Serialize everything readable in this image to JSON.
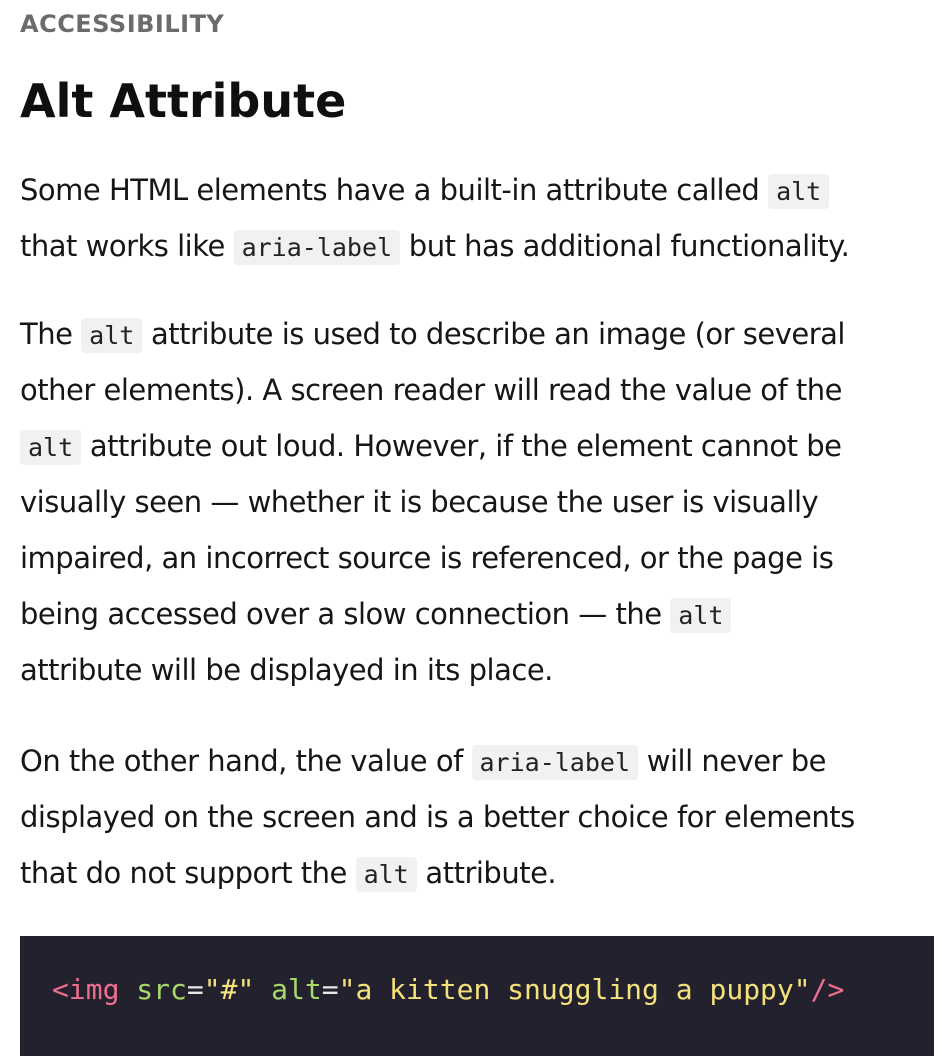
{
  "eyebrow": "ACCESSIBILITY",
  "title": "Alt Attribute",
  "para1": {
    "l1_a": "Some HTML elements have a built-in attribute called ",
    "l1_code": "alt",
    "l2_a": "that works like ",
    "l2_code": "aria-label",
    "l2_b": " but has additional functionality."
  },
  "para2": {
    "l1_a": "The ",
    "l1_code": "alt",
    "l1_b": " attribute is used to describe an image (or several",
    "l2": "other elements). A screen reader will read the value of the",
    "l3_code": "alt",
    "l3_b": " attribute out loud. However, if the element cannot be",
    "l4": "visually seen — whether it is because the user is visually",
    "l5": "impaired, an incorrect source is referenced, or the page is",
    "l6_a": "being accessed over a slow connection — the ",
    "l6_code": "alt",
    "l7": "attribute will be displayed in its place."
  },
  "para3": {
    "l1_a": "On the other hand, the value of ",
    "l1_code": "aria-label",
    "l1_b": " will never be",
    "l2": "displayed on the screen and is a better choice for elements",
    "l3_a": "that do not support the ",
    "l3_code": "alt",
    "l3_b": " attribute."
  },
  "code": {
    "tag_open": "<img",
    "attr1": "src",
    "eq1": "=",
    "val1": "\"#\"",
    "attr2": "alt",
    "eq2": "=",
    "val2": "\"a kitten snuggling a puppy\"",
    "tag_close": "/>"
  },
  "colors": {
    "code_bg": "#24212f",
    "tag": "#ef6f8f",
    "attr": "#a6d96a",
    "string": "#f3e27a"
  }
}
